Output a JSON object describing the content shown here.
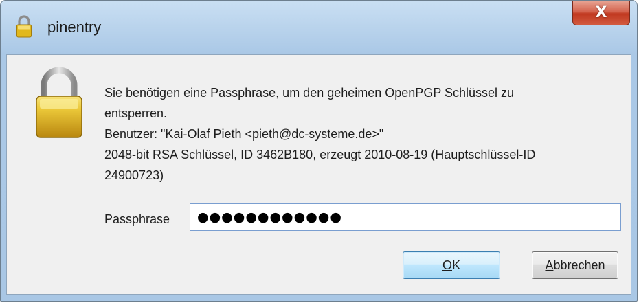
{
  "window": {
    "title": "pinentry",
    "title_icon": "padlock-icon",
    "close_icon": "close-icon",
    "close_glyph": "X"
  },
  "dialog": {
    "icon": "padlock-icon",
    "message_lines": [
      "Sie benötigen eine Passphrase, um den geheimen OpenPGP Schlüssel zu",
      "entsperren.",
      "Benutzer: \"Kai-Olaf Pieth <pieth@dc-systeme.de>\"",
      "2048-bit RSA Schlüssel, ID 3462B180, erzeugt 2010-08-19 (Hauptschlüssel-ID",
      "24900723)"
    ],
    "passphrase_label": "Passphrase",
    "passphrase_value": "●●●●●●●●●●●●",
    "ok_mnemonic": "O",
    "ok_rest": "K",
    "cancel_mnemonic": "A",
    "cancel_rest": "bbrechen"
  },
  "colors": {
    "frame": "#aac8e6",
    "close_button": "#c7432b",
    "client_background": "#f0f0f0",
    "default_button_border": "#3c7fb1"
  }
}
